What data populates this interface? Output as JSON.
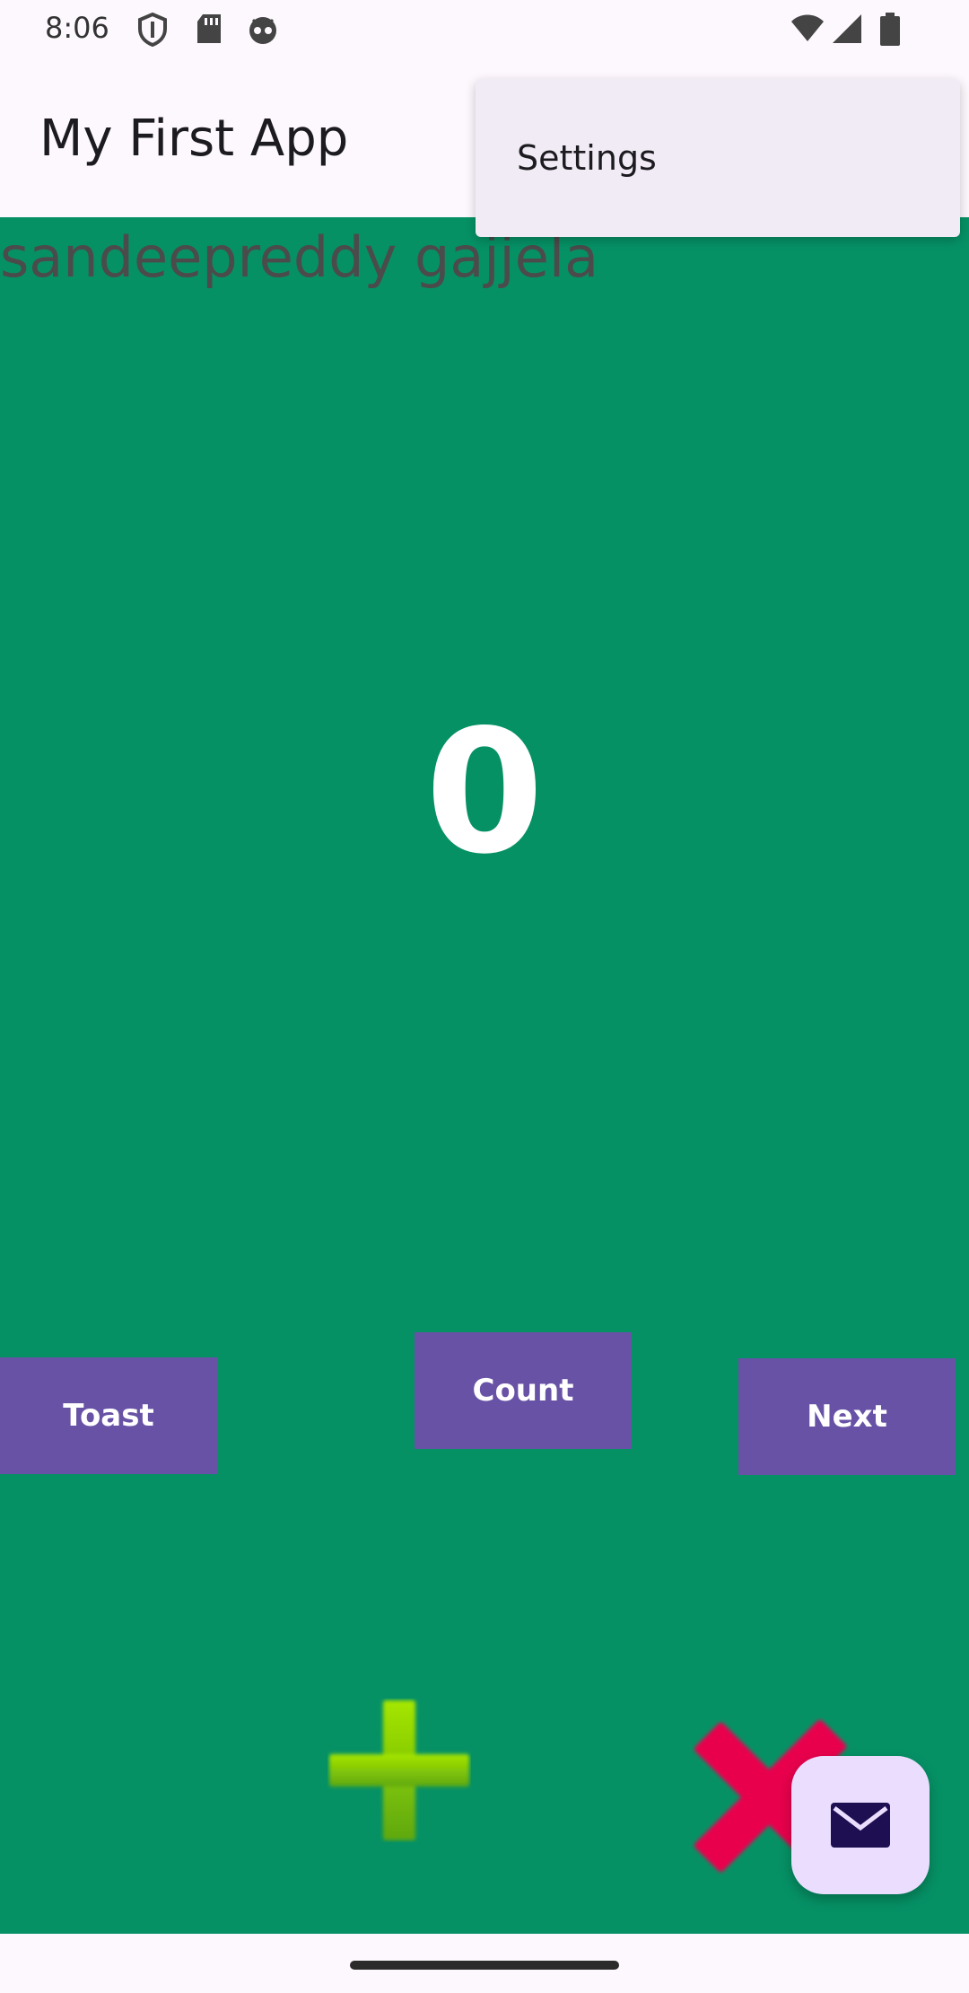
{
  "status_bar": {
    "time": "8:06",
    "icons": [
      "shield-icon",
      "sd-card-icon",
      "robot-icon",
      "wifi-icon",
      "signal-icon",
      "battery-icon"
    ]
  },
  "app_bar": {
    "title": "My First App"
  },
  "overflow_menu": {
    "items": [
      {
        "label": "Settings"
      }
    ]
  },
  "main": {
    "background": "#069165",
    "name_text": "sandeepreddy gajjela",
    "count_value": "0",
    "buttons": {
      "toast": "Toast",
      "count": "Count",
      "next": "Next"
    },
    "button_color": "#6852a6",
    "icons": [
      "plus-icon",
      "close-icon",
      "email-icon"
    ]
  }
}
